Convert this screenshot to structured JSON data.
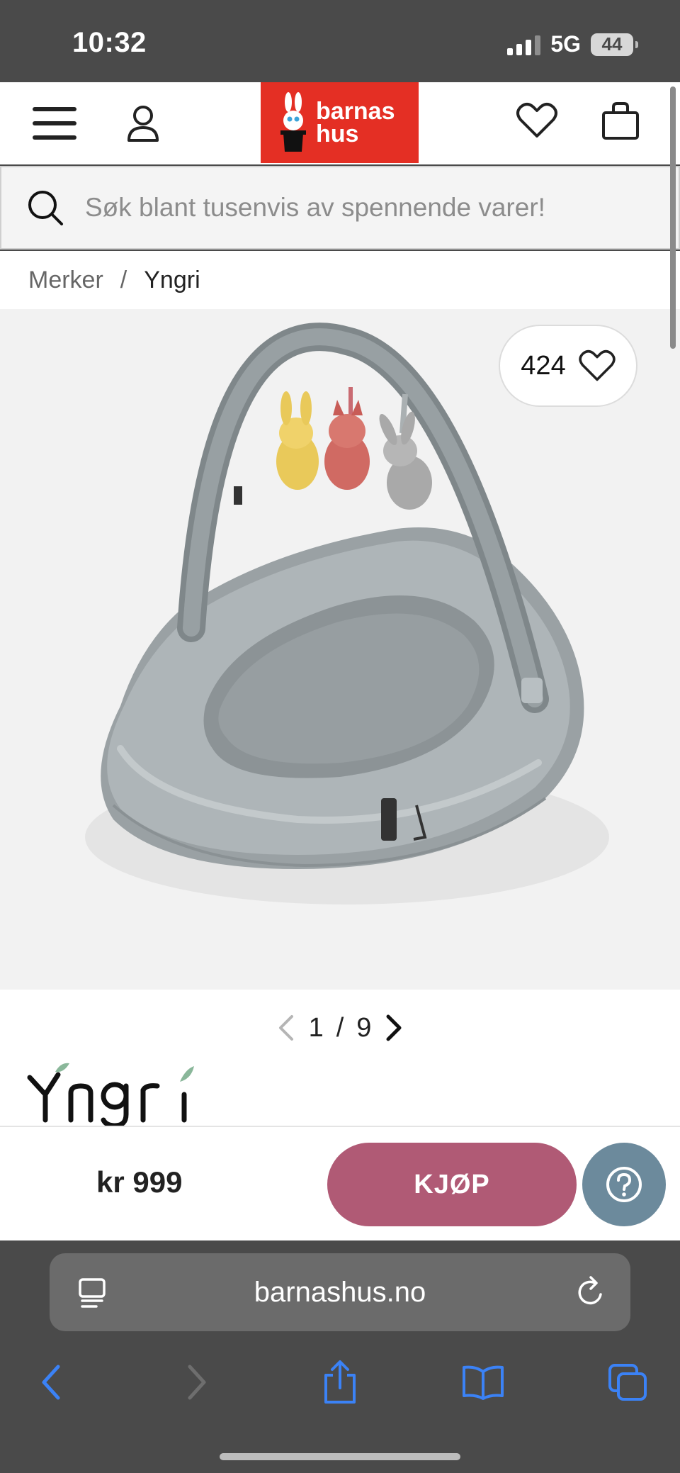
{
  "status_bar": {
    "time": "10:32",
    "network": "5G",
    "battery": "44"
  },
  "header": {
    "menu_icon": "hamburger-icon",
    "account_icon": "user-icon",
    "logo_text": "barnas hus",
    "wishlist_icon": "heart-icon",
    "cart_icon": "bag-icon"
  },
  "search": {
    "placeholder": "Søk blant tusenvis av spennende varer!"
  },
  "breadcrumb": {
    "parent": "Merker",
    "separator": "/",
    "current": "Yngri"
  },
  "product": {
    "favorite_count": "424",
    "image_current": "1",
    "image_separator": "/",
    "image_total": "9",
    "brand": "Yngri"
  },
  "buy_bar": {
    "price": "kr 999",
    "buy_label": "KJØP"
  },
  "browser": {
    "url": "barnashus.no"
  },
  "colors": {
    "brand_red": "#e42f24",
    "buy_button": "#b05a75",
    "help_button": "#6c8a9c",
    "ios_blue": "#3b82f6"
  }
}
